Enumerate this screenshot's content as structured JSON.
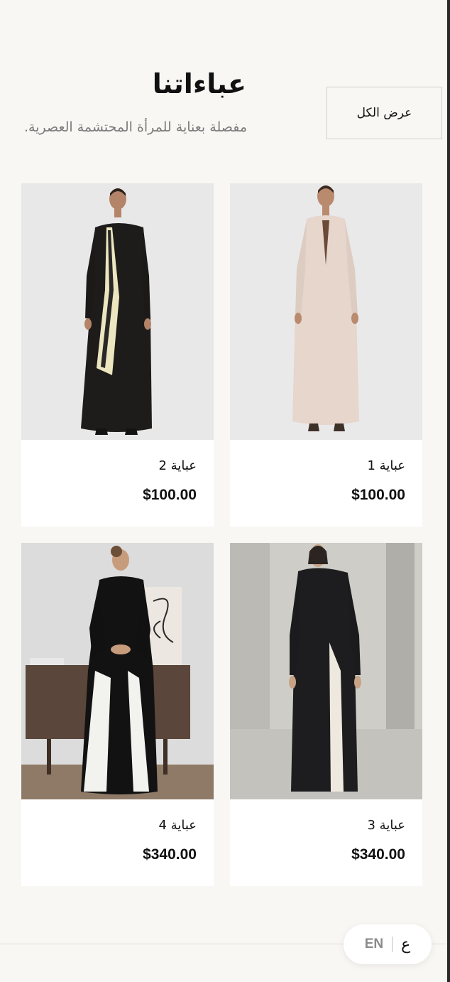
{
  "header": {
    "title": "عباءاتنا",
    "subtitle": "مفصلة بعناية للمرأة المحتشمة العصرية.",
    "view_all_label": "عرض الكل"
  },
  "products": [
    {
      "name": "عباية 1",
      "price": "$100.00"
    },
    {
      "name": "عباية 2",
      "price": "$100.00"
    },
    {
      "name": "عباية 3",
      "price": "$340.00"
    },
    {
      "name": "عباية 4",
      "price": "$340.00"
    }
  ],
  "language_switch": {
    "en_label": "EN",
    "ar_label": "ع"
  },
  "colors": {
    "background": "#f8f7f4",
    "text": "#111111",
    "muted_text": "#7b7b7b",
    "card": "#ffffff"
  }
}
